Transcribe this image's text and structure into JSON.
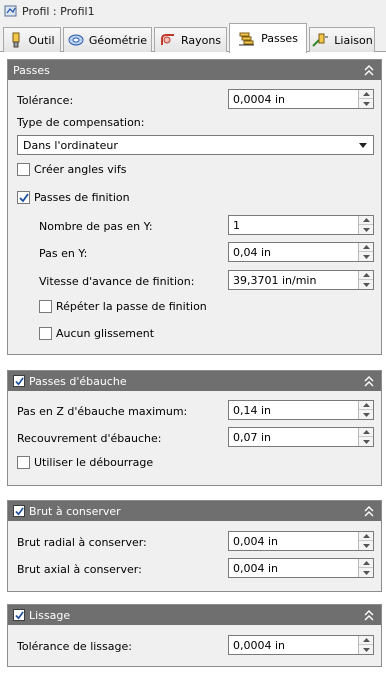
{
  "window": {
    "title": "Profil : Profil1"
  },
  "tabs": [
    {
      "label": "Outil",
      "icon": "tool-icon"
    },
    {
      "label": "Géométrie",
      "icon": "geometry-icon"
    },
    {
      "label": "Rayons",
      "icon": "radii-icon"
    },
    {
      "label": "Passes",
      "icon": "passes-icon",
      "active": true
    },
    {
      "label": "Liaison",
      "icon": "linking-icon"
    }
  ],
  "passes": {
    "header": "Passes",
    "tolerance_label": "Tolérance:",
    "tolerance_value": "0,0004 in",
    "compensation_label": "Type de compensation:",
    "compensation_value": "Dans l'ordinateur",
    "sharp_corners_label": "Créer angles vifs",
    "sharp_corners_checked": false,
    "finishing_label": "Passes de finition",
    "finishing_checked": true,
    "y_steps_label": "Nombre de pas en Y:",
    "y_steps_value": "1",
    "y_step_label": "Pas en Y:",
    "y_step_value": "0,04 in",
    "feed_label": "Vitesse d'avance de finition:",
    "feed_value": "39,3701 in/min",
    "repeat_label": "Répéter la passe de finition",
    "repeat_checked": false,
    "no_slide_label": "Aucun glissement",
    "no_slide_checked": false
  },
  "roughing": {
    "header": "Passes d'ébauche",
    "checked": true,
    "max_z_label": "Pas en Z d'ébauche maximum:",
    "max_z_value": "0,14 in",
    "overlap_label": "Recouvrement d'ébauche:",
    "overlap_value": "0,07 in",
    "rampdown_label": "Utiliser le débourrage",
    "rampdown_checked": false
  },
  "stock": {
    "header": "Brut à conserver",
    "checked": true,
    "radial_label": "Brut radial à conserver:",
    "radial_value": "0,004 in",
    "axial_label": "Brut axial à conserver:",
    "axial_value": "0,004 in"
  },
  "smoothing": {
    "header": "Lissage",
    "checked": true,
    "tolerance_label": "Tolérance de lissage:",
    "tolerance_value": "0,0004 in"
  },
  "colors": {
    "panel_header": "#6f6f6f",
    "check_blue": "#1c4e9c"
  }
}
